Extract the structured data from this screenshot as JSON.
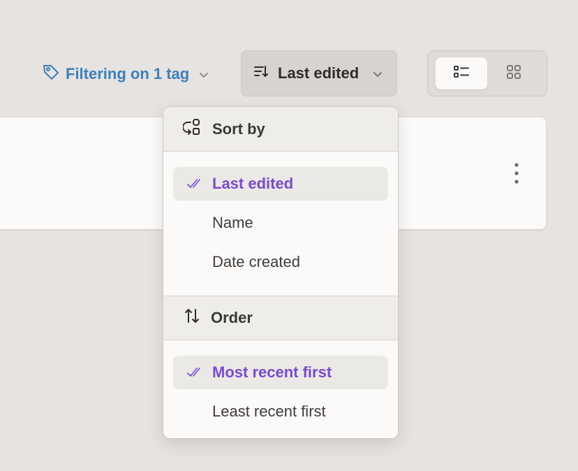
{
  "toolbar": {
    "filter_label": "Filtering on 1 tag",
    "sort_label": "Last edited"
  },
  "sort_menu": {
    "sort_heading": "Sort by",
    "sort_options": [
      {
        "label": "Last edited",
        "selected": true
      },
      {
        "label": "Name",
        "selected": false
      },
      {
        "label": "Date created",
        "selected": false
      }
    ],
    "order_heading": "Order",
    "order_options": [
      {
        "label": "Most recent first",
        "selected": true
      },
      {
        "label": "Least recent first",
        "selected": false
      }
    ]
  },
  "view_toggle": {
    "selected": "list"
  },
  "icons": {
    "filter": "tag-icon",
    "sort": "sort-lines-icon",
    "chevron": "chevron-down-icon",
    "list": "list-view-icon",
    "grid": "grid-view-icon",
    "sort_by": "sort-shapes-icon",
    "order": "arrows-up-down-icon",
    "check": "double-check-icon",
    "more": "more-vertical-icon"
  },
  "colors": {
    "background": "#e6e3e0",
    "accent_blue": "#3c80bd",
    "accent_purple": "#7a49d6",
    "selected_row": "#ebe9e6",
    "menu_bg": "#fbfaf9"
  }
}
